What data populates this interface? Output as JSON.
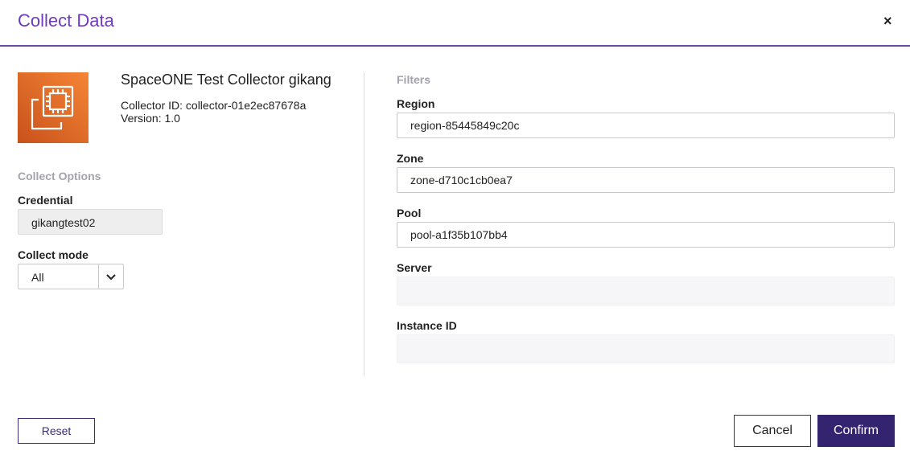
{
  "modal": {
    "title": "Collect Data",
    "close_label": "×"
  },
  "collector": {
    "icon": "chip-copy-icon",
    "name": "SpaceONE Test Collector gikang",
    "id_text": "Collector ID: collector-01e2ec87678a",
    "version_text": "Version: 1.0",
    "logo_colors": [
      "#c8511b",
      "#f58536"
    ]
  },
  "collect_options": {
    "section_label": "Collect Options",
    "credential_label": "Credential",
    "credential_value": "gikangtest02",
    "mode_label": "Collect mode",
    "mode_value": "All"
  },
  "filters": {
    "section_label": "Filters",
    "region_label": "Region",
    "region_value": "region-85445849c20c",
    "zone_label": "Zone",
    "zone_value": "zone-d710c1cb0ea7",
    "pool_label": "Pool",
    "pool_value": "pool-a1f35b107bb4",
    "server_label": "Server",
    "server_value": "",
    "instance_label": "Instance ID",
    "instance_value": ""
  },
  "footer": {
    "reset_label": "Reset",
    "cancel_label": "Cancel",
    "confirm_label": "Confirm"
  },
  "colors": {
    "accent": "#6d3bc0",
    "primary_button": "#34236f"
  }
}
